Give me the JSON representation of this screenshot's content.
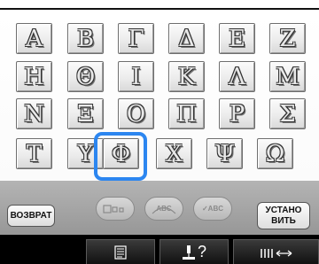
{
  "keyboard": {
    "rows": [
      [
        "Α",
        "Β",
        "Γ",
        "Δ",
        "Ε",
        "Ζ"
      ],
      [
        "Η",
        "Θ",
        "Ι",
        "Κ",
        "Λ",
        "Μ"
      ],
      [
        "Ν",
        "Ξ",
        "Ο",
        "Π",
        "Ρ",
        "Σ"
      ],
      [
        "Τ",
        "Υ",
        "Φ",
        "Χ",
        "Ψ",
        "Ω"
      ]
    ],
    "selected": "Φ"
  },
  "toolbar": {
    "back_label": "ВОЗВРАТ",
    "set_label_line1": "УСТАНО",
    "set_label_line2": "ВИТЬ",
    "check_abc_label": "✓ABC",
    "wave_abc_label": "ABC"
  },
  "bottom_tabs": {
    "help_label": "?"
  },
  "colors": {
    "selection": "#2c86f0"
  }
}
